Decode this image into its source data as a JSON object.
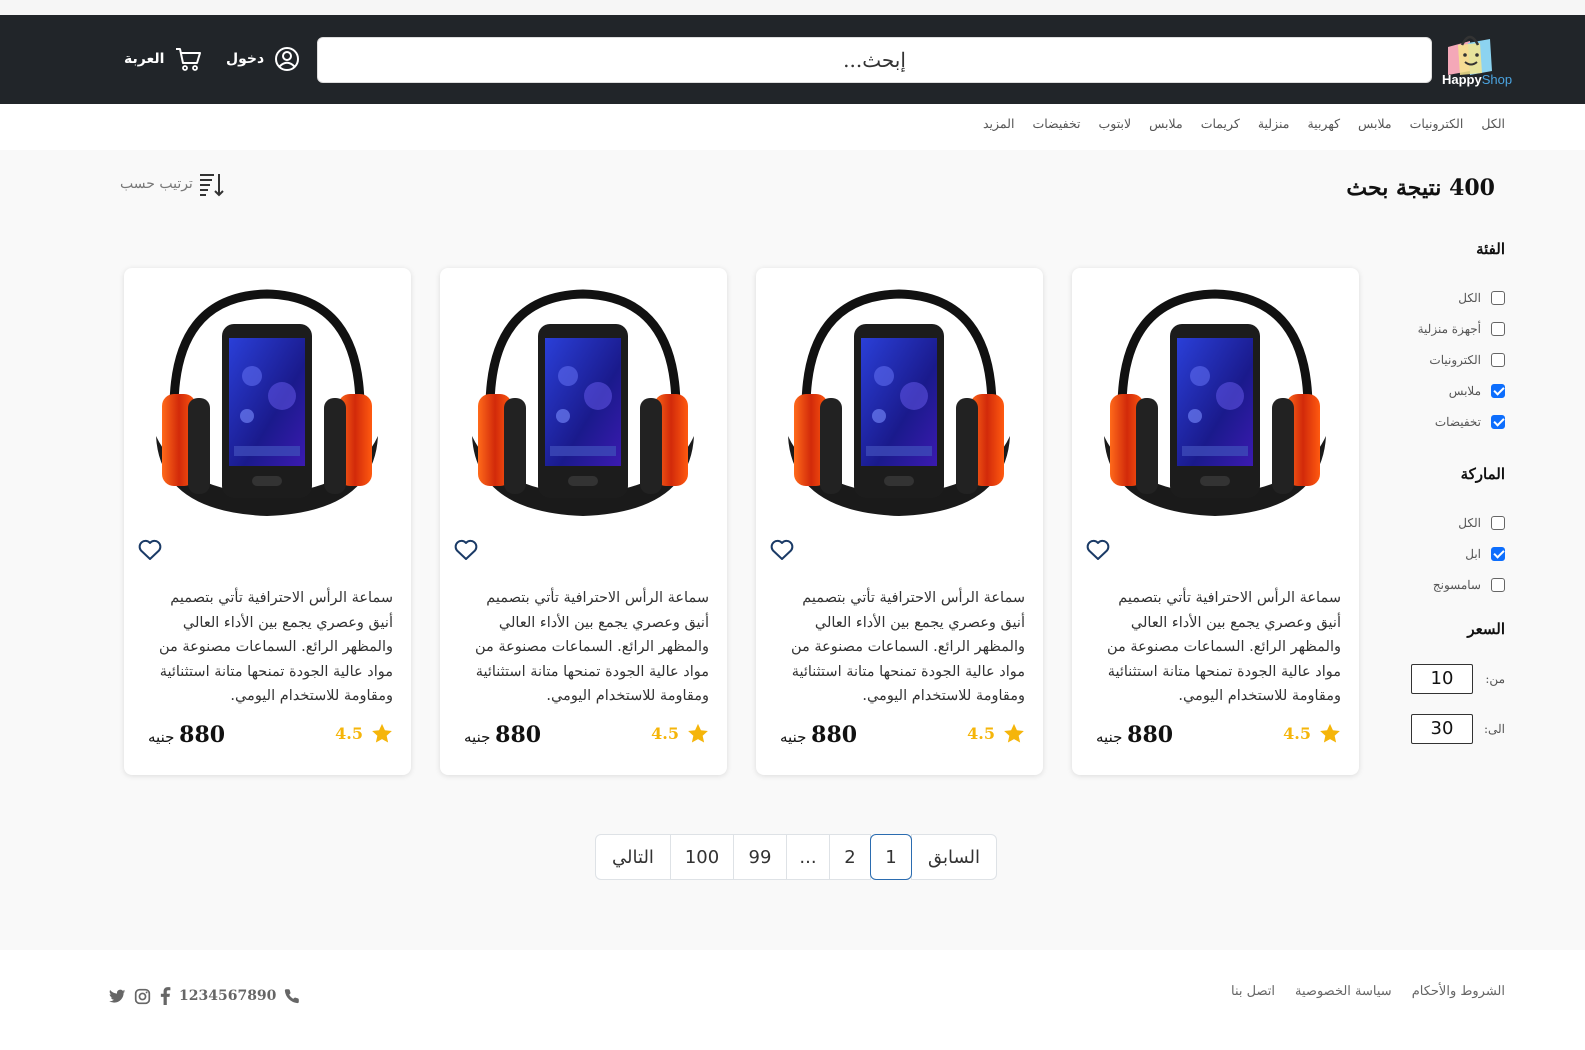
{
  "header": {
    "logo_text_1": "Happy",
    "logo_text_2": "Shop",
    "search_placeholder": "إبحث...",
    "login_label": "دخول",
    "cart_label": "العربة"
  },
  "categories": [
    "الكل",
    "الكترونيات",
    "ملابس",
    "كهربية",
    "منزلية",
    "كريمات",
    "ملابس",
    "لابتوب",
    "تخفيضات",
    "المزيد"
  ],
  "results": {
    "count_text": "400 نتيجة بحث",
    "sort_label": "ترتيب حسب"
  },
  "filters": {
    "category_title": "الفئة",
    "category_options": [
      {
        "label": "الكل",
        "checked": false
      },
      {
        "label": "أجهزة منزلية",
        "checked": false
      },
      {
        "label": "الكترونيات",
        "checked": false
      },
      {
        "label": "ملابس",
        "checked": true
      },
      {
        "label": "تخفيضات",
        "checked": true
      }
    ],
    "brand_title": "الماركة",
    "brand_options": [
      {
        "label": "الكل",
        "checked": false
      },
      {
        "label": "ابل",
        "checked": true
      },
      {
        "label": "سامسونج",
        "checked": false
      }
    ],
    "price_title": "السعر",
    "price_from_label": "من:",
    "price_from_value": "10",
    "price_to_label": "الى:",
    "price_to_value": "30"
  },
  "products": [
    {
      "description": "سماعة الرأس الاحترافية تأتي بتصميم أنيق وعصري يجمع بين الأداء العالي والمظهر الرائع. السماعات مصنوعة من مواد عالية الجودة تمنحها متانة استثنائية ومقاومة للاستخدام اليومي.",
      "price": "880",
      "currency": "جنيه",
      "rating": "4.5"
    },
    {
      "description": "سماعة الرأس الاحترافية تأتي بتصميم أنيق وعصري يجمع بين الأداء العالي والمظهر الرائع. السماعات مصنوعة من مواد عالية الجودة تمنحها متانة استثنائية ومقاومة للاستخدام اليومي.",
      "price": "880",
      "currency": "جنيه",
      "rating": "4.5"
    },
    {
      "description": "سماعة الرأس الاحترافية تأتي بتصميم أنيق وعصري يجمع بين الأداء العالي والمظهر الرائع. السماعات مصنوعة من مواد عالية الجودة تمنحها متانة استثنائية ومقاومة للاستخدام اليومي.",
      "price": "880",
      "currency": "جنيه",
      "rating": "4.5"
    },
    {
      "description": "سماعة الرأس الاحترافية تأتي بتصميم أنيق وعصري يجمع بين الأداء العالي والمظهر الرائع. السماعات مصنوعة من مواد عالية الجودة تمنحها متانة استثنائية ومقاومة للاستخدام اليومي.",
      "price": "880",
      "currency": "جنيه",
      "rating": "4.5"
    }
  ],
  "pagination": {
    "next_label": "التالي",
    "prev_label": "السابق",
    "pages": [
      "100",
      "99",
      "...",
      "2",
      "1"
    ],
    "active_page": "1"
  },
  "footer": {
    "links": [
      "الشروط والأحكام",
      "سياسة الخصوصية",
      "اتصل بنا"
    ],
    "phone": "1234567890",
    "social_icons": [
      "twitter-icon",
      "instagram-icon",
      "facebook-icon"
    ]
  },
  "colors": {
    "header_bg": "#212529",
    "accent": "#0d6efd",
    "star": "#f5b50a"
  }
}
